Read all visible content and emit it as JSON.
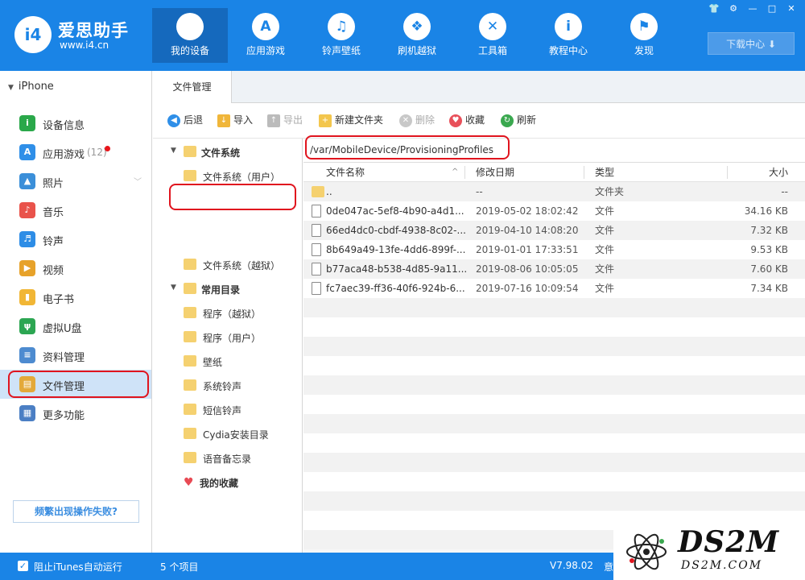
{
  "app": {
    "logo_badge": "i4",
    "name": "爱思助手",
    "url": "www.i4.cn"
  },
  "nav": [
    {
      "label": "我的设备",
      "icon": "apple-icon",
      "glyph": ""
    },
    {
      "label": "应用游戏",
      "icon": "app-store-icon",
      "glyph": "A"
    },
    {
      "label": "铃声壁纸",
      "icon": "music-wallpaper-icon",
      "glyph": "♫"
    },
    {
      "label": "刷机越狱",
      "icon": "dropbox-box-icon",
      "glyph": "❖"
    },
    {
      "label": "工具箱",
      "icon": "tools-icon",
      "glyph": "✕"
    },
    {
      "label": "教程中心",
      "icon": "info-icon",
      "glyph": "i"
    },
    {
      "label": "发现",
      "icon": "flag-icon",
      "glyph": "⚑"
    }
  ],
  "window_controls": [
    "👕",
    "⚙",
    "—",
    "□",
    "✕"
  ],
  "download_center": "下载中心 ⬇",
  "device": {
    "name": "iPhone"
  },
  "sidebar": [
    {
      "label": "设备信息",
      "icon": "device-info-icon",
      "glyph": "i",
      "color": "#2aa84a"
    },
    {
      "label": "应用游戏",
      "icon": "app-games-icon",
      "glyph": "A",
      "color": "#2f8fe8",
      "count": "(12)",
      "badge": true
    },
    {
      "label": "照片",
      "icon": "photos-icon",
      "glyph": "▲",
      "color": "#3b8fd9",
      "chevron": "﹀"
    },
    {
      "label": "音乐",
      "icon": "music-icon",
      "glyph": "♪",
      "color": "#e9534b"
    },
    {
      "label": "铃声",
      "icon": "bell-icon",
      "glyph": "♬",
      "color": "#2e8de6"
    },
    {
      "label": "视频",
      "icon": "video-icon",
      "glyph": "▶",
      "color": "#e7a22a"
    },
    {
      "label": "电子书",
      "icon": "ebook-icon",
      "glyph": "▮",
      "color": "#f1b635"
    },
    {
      "label": "虚拟U盘",
      "icon": "usb-icon",
      "glyph": "ψ",
      "color": "#2ca652"
    },
    {
      "label": "资料管理",
      "icon": "contacts-icon",
      "glyph": "≡",
      "color": "#4d8bd0"
    },
    {
      "label": "文件管理",
      "icon": "file-manager-icon",
      "glyph": "▤",
      "color": "#e3a93a",
      "active": true
    },
    {
      "label": "更多功能",
      "icon": "more-functions-icon",
      "glyph": "▦",
      "color": "#4b7fc4"
    }
  ],
  "help_button": "频繁出现操作失败?",
  "tab": {
    "label": "文件管理"
  },
  "toolbar": {
    "back": "后退",
    "import": "导入",
    "export": "导出",
    "new_folder": "新建文件夹",
    "delete": "删除",
    "favorite": "收藏",
    "refresh": "刷新"
  },
  "tree": {
    "filesystem": "文件系统",
    "fs_user": "文件系统（用户）",
    "fs_jailbreak": "文件系统（越狱）",
    "common": "常用目录",
    "common_items": [
      "程序（越狱）",
      "程序（用户）",
      "壁纸",
      "系统铃声",
      "短信铃声",
      "Cydia安装目录",
      "语音备忘录"
    ],
    "favorites": "我的收藏"
  },
  "path": "/var/MobileDevice/ProvisioningProfiles",
  "columns": {
    "name": "文件名称",
    "date": "修改日期",
    "type": "类型",
    "size": "大小"
  },
  "files": [
    {
      "name": "..",
      "date": "--",
      "type": "文件夹",
      "size": "--",
      "folder": true
    },
    {
      "name": "0de047ac-5ef8-4b90-a4d1...",
      "date": "2019-05-02 18:02:42",
      "type": "文件",
      "size": "34.16 KB"
    },
    {
      "name": "66ed4dc0-cbdf-4938-8c02-...",
      "date": "2019-04-10 14:08:20",
      "type": "文件",
      "size": "7.32 KB"
    },
    {
      "name": "8b649a49-13fe-4dd6-899f-...",
      "date": "2019-01-01 17:33:51",
      "type": "文件",
      "size": "9.53 KB"
    },
    {
      "name": "b77aca48-b538-4d85-9a11...",
      "date": "2019-08-06 10:05:05",
      "type": "文件",
      "size": "7.60 KB"
    },
    {
      "name": "fc7aec39-ff36-40f6-924b-6...",
      "date": "2019-07-16 10:09:54",
      "type": "文件",
      "size": "7.34 KB"
    }
  ],
  "status": {
    "itunes_block": "阻止iTunes自动运行",
    "item_count": "5 个项目",
    "version": "V7.98.02",
    "extra": "意"
  },
  "watermark": {
    "big": "DS2M",
    "small": "DS2M.COM"
  }
}
